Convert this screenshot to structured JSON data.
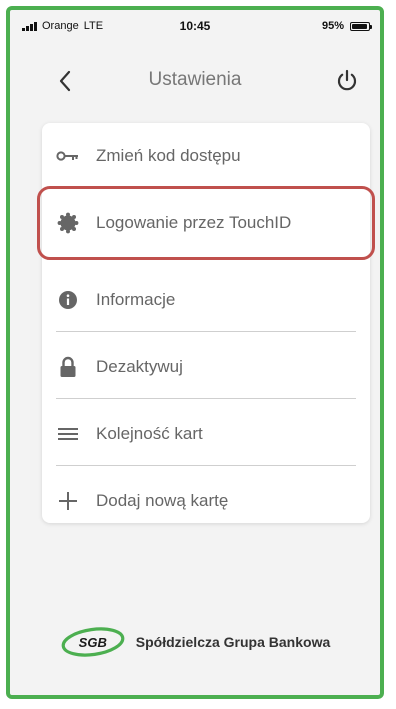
{
  "status_bar": {
    "carrier": "Orange",
    "network": "LTE",
    "time": "10:45",
    "battery": "95%",
    "battery_level": 0.95
  },
  "header": {
    "title": "Ustawienia"
  },
  "settings": {
    "items": [
      {
        "label": "Zmień kod dostępu",
        "icon": "key-icon"
      },
      {
        "label": "Logowanie przez TouchID",
        "icon": "fingerprint-icon",
        "highlighted": true
      },
      {
        "label": "Informacje",
        "icon": "info-icon"
      },
      {
        "label": "Dezaktywuj",
        "icon": "lock-icon"
      },
      {
        "label": "Kolejność kart",
        "icon": "menu-icon"
      },
      {
        "label": "Dodaj nową kartę",
        "icon": "plus-icon"
      }
    ]
  },
  "footer": {
    "logo_text": "SGB",
    "bank_name": "Spółdzielcza Grupa Bankowa"
  },
  "colors": {
    "frame_border": "#4caf50",
    "highlight_border": "#c0504d",
    "logo_green": "#4caf50"
  }
}
